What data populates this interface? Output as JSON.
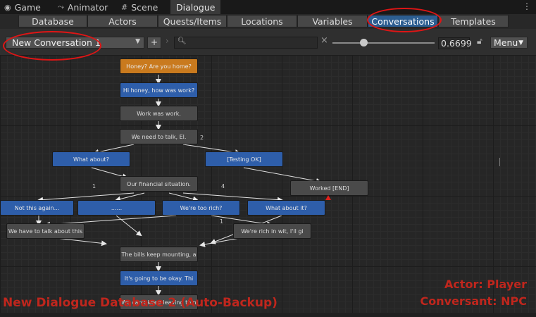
{
  "window_tabs": [
    {
      "label": "Game",
      "icon": "gamepad-icon"
    },
    {
      "label": "Animator",
      "icon": "animator-icon"
    },
    {
      "label": "Scene",
      "icon": "grid-icon"
    },
    {
      "label": "Dialogue",
      "icon": ""
    }
  ],
  "toolbar_tabs": [
    "Database",
    "Actors",
    "Quests/Items",
    "Locations",
    "Variables",
    "Conversations",
    "Templates"
  ],
  "selected_tab": "Conversations",
  "conversation_select": "New Conversation 1",
  "add_label": "+",
  "search": {
    "value": "",
    "placeholder": ""
  },
  "zoom": "0.6699",
  "zoom_fraction": 0.27,
  "menu_label": "Menu",
  "nodes": [
    {
      "text": "Honey? Are you home?",
      "kind": "start"
    },
    {
      "text": "Hi honey, how was work?",
      "kind": "player"
    },
    {
      "text": "Work was work.",
      "kind": "npc"
    },
    {
      "text": "We need to talk, El.",
      "kind": "npc"
    },
    {
      "text": "What about?",
      "kind": "player"
    },
    {
      "text": "[Testing OK]",
      "kind": "player"
    },
    {
      "text": "Our financial situation.",
      "kind": "npc"
    },
    {
      "text": "Worked [END]",
      "kind": "npc"
    },
    {
      "text": "Not this again...",
      "kind": "player"
    },
    {
      "text": "......",
      "kind": "player"
    },
    {
      "text": "We're too rich?",
      "kind": "player"
    },
    {
      "text": "What about it?",
      "kind": "player"
    },
    {
      "text": "We have to talk about this",
      "kind": "npc"
    },
    {
      "text": "We're rich in wit, I'll gi",
      "kind": "npc"
    },
    {
      "text": "The bills keep mounting, a",
      "kind": "npc"
    },
    {
      "text": "It's going to be okay. Thi",
      "kind": "player"
    },
    {
      "text": "We can't keep leaving thin",
      "kind": "npc"
    }
  ],
  "link_numbers": [
    "2",
    "1",
    "4",
    "1"
  ],
  "watermark_database": "New Dialogue Database 2 (Auto-Backup)",
  "actor_line": "Actor: Player",
  "conversant_line": "Conversant: NPC",
  "colors": {
    "player": "#2e5eaa",
    "npc": "#4a4a4a",
    "start": "#c97a1e",
    "selected_tab": "#2d5e91",
    "annotation": "#e01515"
  }
}
